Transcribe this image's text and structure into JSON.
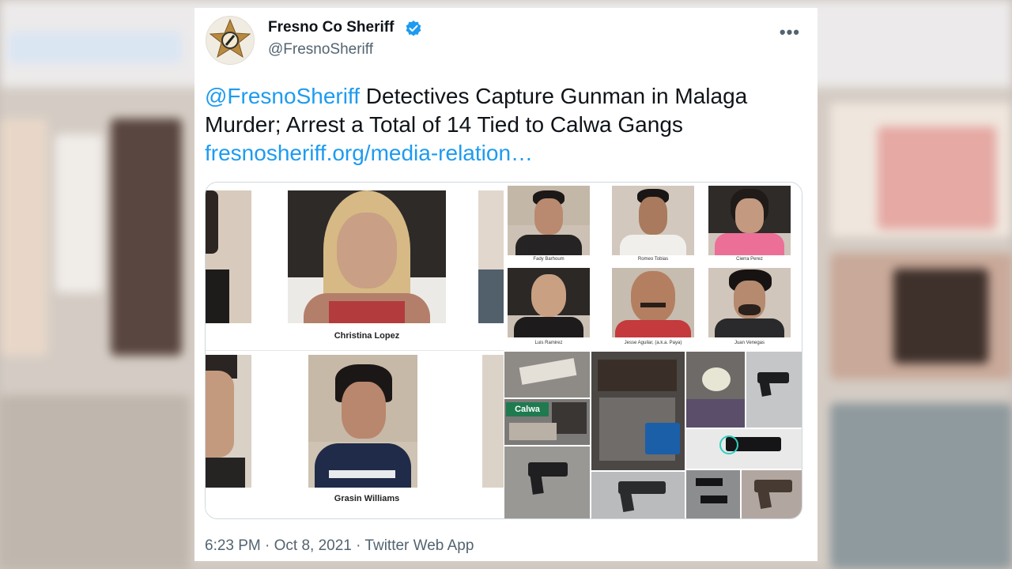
{
  "tweet": {
    "display_name": "Fresno Co Sheriff",
    "verified_icon": "verified-badge-icon",
    "handle": "@FresnoSheriff",
    "more_icon": "more-options-icon",
    "text_mention": "@FresnoSheriff",
    "text_body": " Detectives Capture Gunman in Malaga Murder; Arrest a Total of 14 Tied to Calwa Gangs",
    "link": "fresnosheriff.org/media-relation…",
    "timestamp": "6:23 PM · Oct 8, 2021 · Twitter Web App"
  },
  "media": {
    "left_panel_names": [
      "Christina Lopez",
      "Grasin Williams"
    ],
    "right_panel_names": [
      "Fady Barhoum",
      "Romeo Tobias",
      "Cierra Perez",
      "Luis Ramirez",
      "Jesse Aguilar, (a.k.a. Paya)",
      "Juan Venegas"
    ],
    "street_sign_text": "Calwa"
  },
  "colors": {
    "brand_blue": "#1d9bf0",
    "text_primary": "#0f1419",
    "text_secondary": "#536471"
  }
}
